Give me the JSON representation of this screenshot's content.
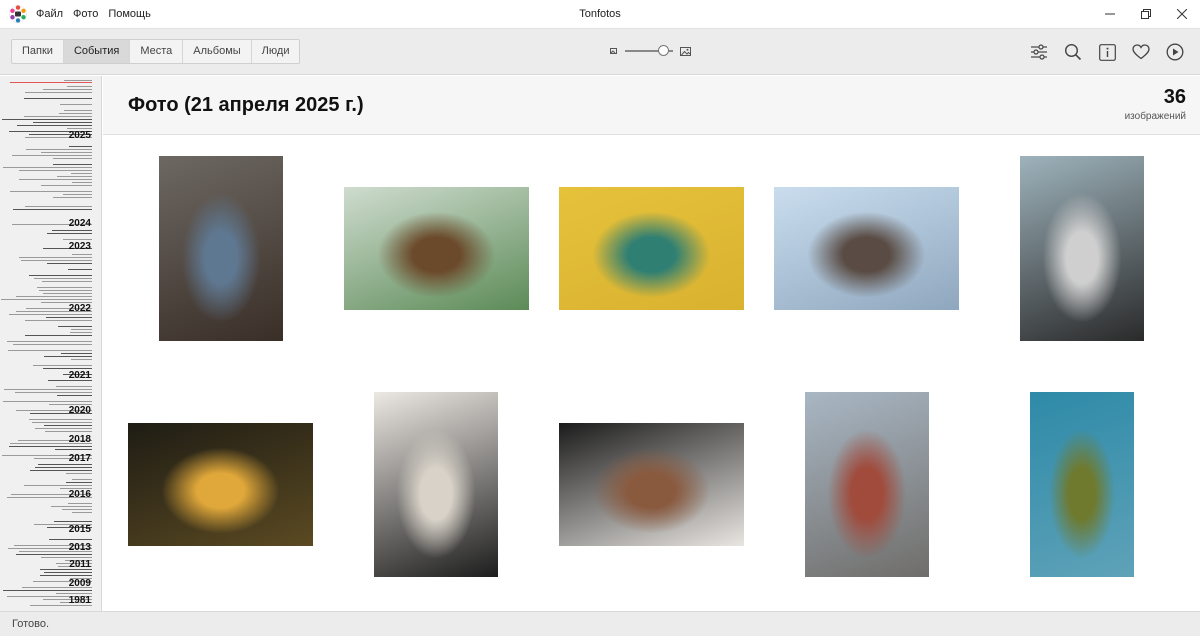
{
  "window": {
    "title": "Tonfotos",
    "menu": [
      "Файл",
      "Фото",
      "Помощь"
    ]
  },
  "toolbar": {
    "tabs": [
      {
        "label": "Папки",
        "active": false
      },
      {
        "label": "События",
        "active": true
      },
      {
        "label": "Места",
        "active": false
      },
      {
        "label": "Альбомы",
        "active": false
      },
      {
        "label": "Люди",
        "active": false
      }
    ],
    "zoom_level": 0.9,
    "icons": [
      "filter-settings-icon",
      "search-icon",
      "info-icon",
      "heart-icon",
      "play-icon"
    ]
  },
  "timeline": {
    "years": [
      "2025",
      "2024",
      "2023",
      "2022",
      "2021",
      "2020",
      "2018",
      "2017",
      "2016",
      "2015",
      "2013",
      "2011",
      "2009",
      "1981"
    ]
  },
  "header": {
    "title": "Фото (21 апреля 2025 г.)",
    "count": "36",
    "count_label": "изображений"
  },
  "photos": [
    {
      "name": "photo-woman-denim-jacket",
      "colors": [
        "#6d6862",
        "#3a2e28",
        "#5f7891"
      ]
    },
    {
      "name": "photo-woman-window-palms",
      "colors": [
        "#cfdccf",
        "#5c8b57",
        "#6b4a2b"
      ]
    },
    {
      "name": "photo-woman-yellow-wall",
      "colors": [
        "#e6c23b",
        "#d9b230",
        "#2f7f73"
      ]
    },
    {
      "name": "photo-group-friends-sunset",
      "colors": [
        "#c9ddee",
        "#8fa7be",
        "#5a4c44"
      ]
    },
    {
      "name": "photo-woman-portrait-office",
      "colors": [
        "#9eb3bc",
        "#2a2a2a",
        "#cfcfcf"
      ]
    },
    {
      "name": "photo-city-night-bokeh",
      "colors": [
        "#1e1c14",
        "#5b4a22",
        "#e0a83a"
      ]
    },
    {
      "name": "photo-woman-sitting-sofa",
      "colors": [
        "#ece8e3",
        "#1d1d1d",
        "#d8d2c8"
      ]
    },
    {
      "name": "photo-man-sunglasses-brick",
      "colors": [
        "#1b1b1b",
        "#e9e6e2",
        "#8a5a3f"
      ]
    },
    {
      "name": "photo-woman-city-street",
      "colors": [
        "#a9b7c4",
        "#6f6d6a",
        "#a04b3c"
      ]
    },
    {
      "name": "photo-woman-hill-suitcase",
      "colors": [
        "#2d8aa8",
        "#5fa2b8",
        "#6f7a2f"
      ]
    }
  ],
  "status": {
    "text": "Готово."
  }
}
